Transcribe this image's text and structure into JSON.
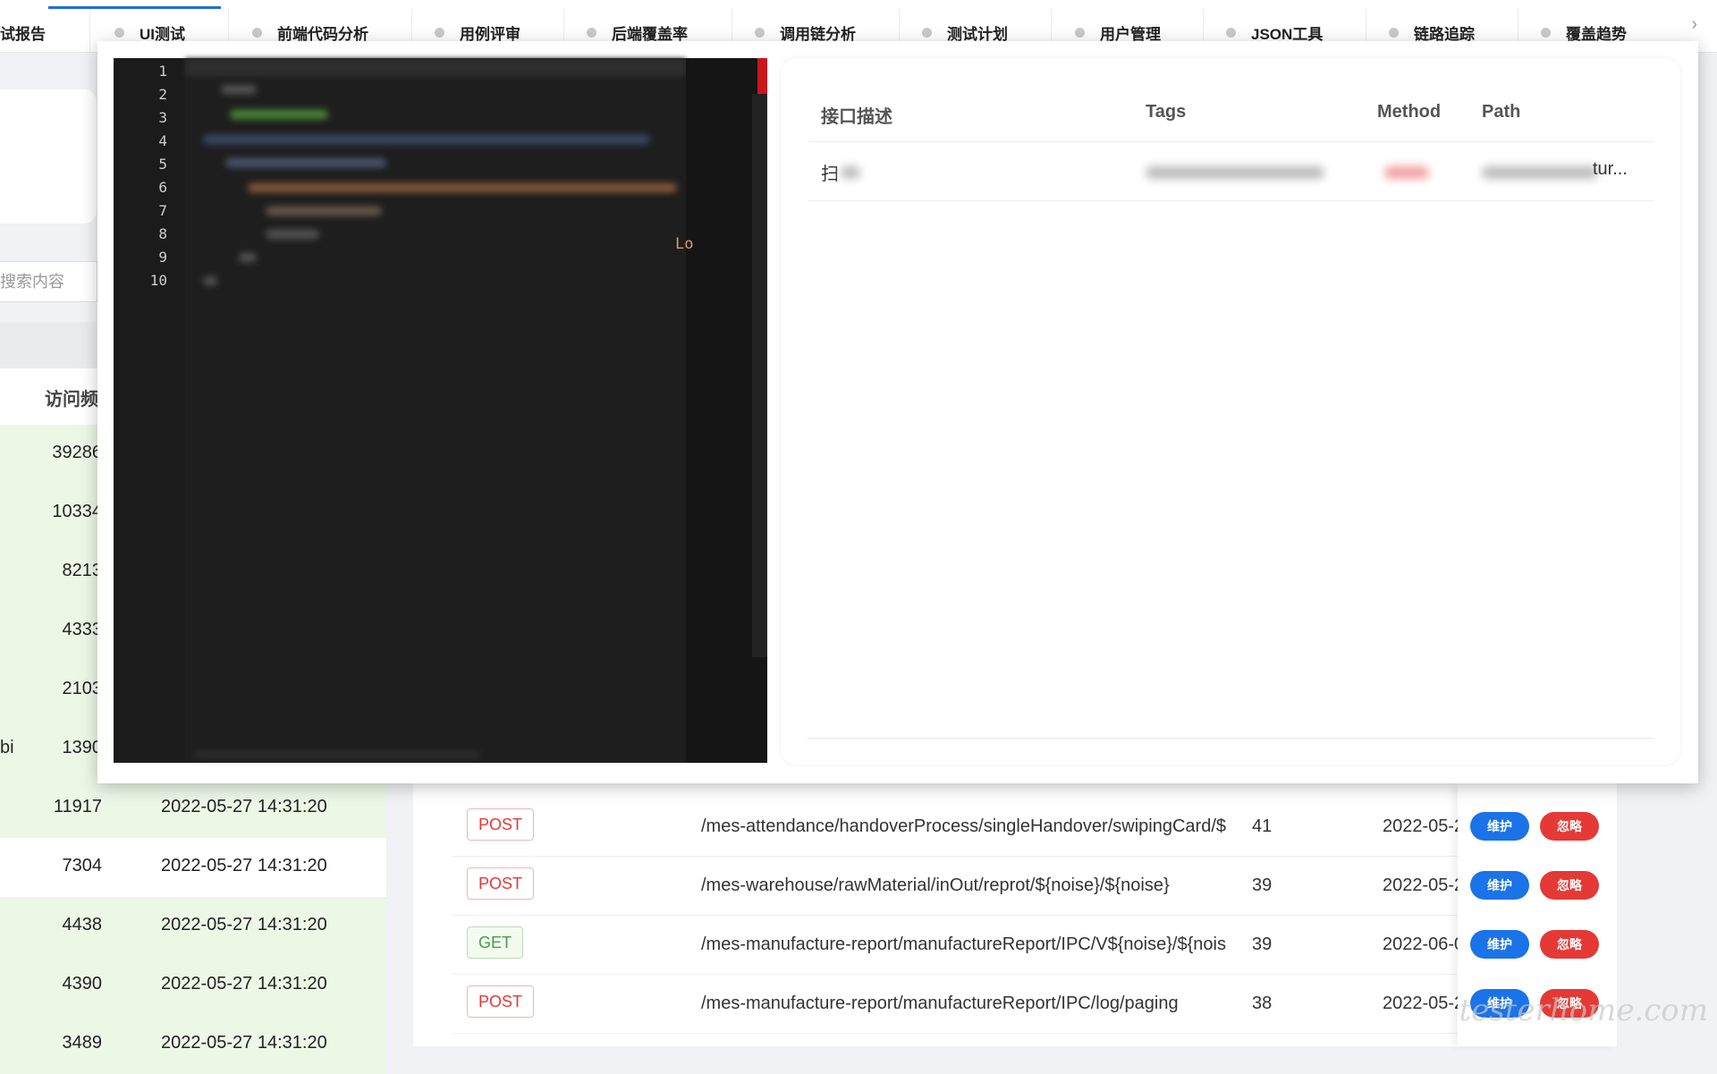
{
  "tabs": [
    {
      "label": "试报告"
    },
    {
      "label": "UI测试"
    },
    {
      "label": "前端代码分析"
    },
    {
      "label": "用例评审"
    },
    {
      "label": "后端覆盖率"
    },
    {
      "label": "调用链分析"
    },
    {
      "label": "测试计划"
    },
    {
      "label": "用户管理"
    },
    {
      "label": "JSON工具"
    },
    {
      "label": "链路追踪"
    },
    {
      "label": "覆盖趋势"
    }
  ],
  "tab_scroll_icon": "chevron-right-icon",
  "left_panel": {
    "search_placeholder": "搜索内容",
    "column_header": "访问频",
    "row_fragment": "bi",
    "rows": [
      {
        "count": "39286",
        "time": ""
      },
      {
        "count": "10334",
        "time": ""
      },
      {
        "count": "8213",
        "time": ""
      },
      {
        "count": "4333",
        "time": ""
      },
      {
        "count": "2103",
        "time": ""
      },
      {
        "count": "1390",
        "time": ""
      },
      {
        "count": "11917",
        "time": "2022-05-27 14:31:20"
      },
      {
        "count": "7304",
        "time": "2022-05-27 14:31:20"
      },
      {
        "count": "4438",
        "time": "2022-05-27 14:31:20"
      },
      {
        "count": "4390",
        "time": "2022-05-27 14:31:20"
      },
      {
        "count": "3489",
        "time": "2022-05-27 14:31:20"
      }
    ]
  },
  "api_table": {
    "rows": [
      {
        "method": "POST",
        "path": "/mes-attendance/handoverProcess/singleHandover/swipingCard/$",
        "count": "41",
        "date": "2022-05-2"
      },
      {
        "method": "POST",
        "path": "/mes-warehouse/rawMaterial/inOut/reprot/${noise}/${noise}",
        "count": "39",
        "date": "2022-05-2"
      },
      {
        "method": "GET",
        "path": "/mes-manufacture-report/manufactureReport/IPC/V${noise}/${nois",
        "count": "39",
        "date": "2022-06-0"
      },
      {
        "method": "POST",
        "path": "/mes-manufacture-report/manufactureReport/IPC/log/paging",
        "count": "38",
        "date": "2022-05-2"
      }
    ],
    "maintain_label": "维护",
    "ignore_label": "忽略"
  },
  "watermark": "testerhome.com",
  "modal": {
    "editor": {
      "line_numbers": [
        "1",
        "2",
        "3",
        "4",
        "5",
        "6",
        "7",
        "8",
        "9",
        "10"
      ],
      "visible_suffix": "Lo"
    },
    "detail_table": {
      "headers": {
        "desc": "接口描述",
        "tags": "Tags",
        "method": "Method",
        "path": "Path"
      },
      "row": {
        "desc": "扫",
        "path_suffix": "tur..."
      }
    }
  },
  "colors": {
    "accent": "#1e6fd9",
    "post": "#e53935",
    "get": "#43a047",
    "row_green": "#edf7e6"
  }
}
